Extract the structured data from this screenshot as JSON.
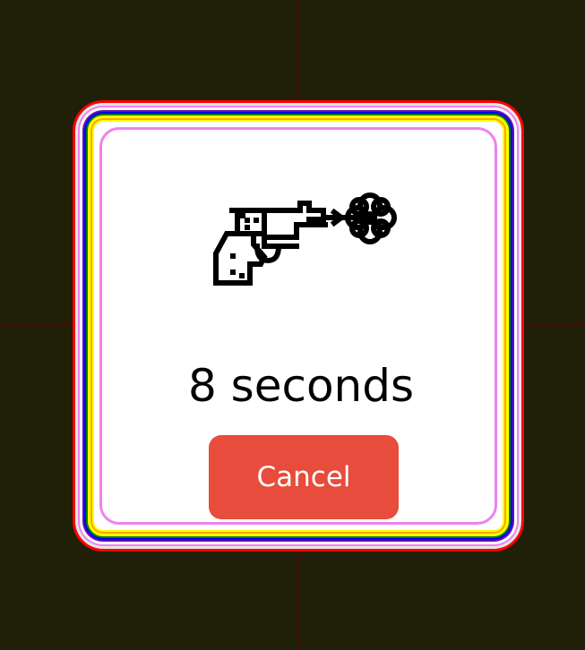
{
  "dialog": {
    "icon": "revolver-with-flower-icon",
    "countdown_text": "8 seconds",
    "cancel_label": "Cancel"
  },
  "colors": {
    "background": "#201f07",
    "cancel_button": "#e74c3c",
    "border_rainbow": [
      "#ff0000",
      "#ffff00",
      "#ffa500",
      "#ffff00",
      "#008000",
      "#0000ff",
      "#6a0dad",
      "#ee82ee"
    ]
  }
}
